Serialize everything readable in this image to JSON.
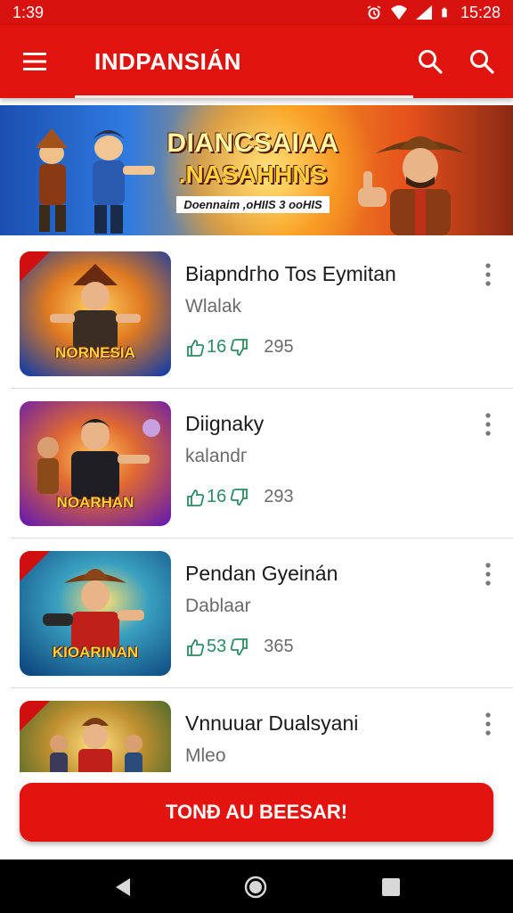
{
  "status_bar": {
    "time_left": "1:39",
    "time_right": "15:28",
    "icons": [
      "alarm-icon",
      "wifi-icon",
      "signal-icon",
      "battery-icon"
    ]
  },
  "app_bar": {
    "title": "INDPANSIÁN",
    "icons": [
      "menu-icon",
      "search-icon",
      "search-icon"
    ],
    "color": "#e0140f"
  },
  "banner": {
    "line1": "DIANCSAIAA",
    "line2": ".NASAHHNS",
    "line3": "Doennaim ,oHIIS 3 ooHIS"
  },
  "games": [
    {
      "title": "Biapndгho Tos Eymitan",
      "subtitle": "Wlalak",
      "likes": "16",
      "count": "295",
      "thumb_caption": "NORNESIA",
      "thumb_colors": [
        "#1b3fa0",
        "#f1a020"
      ]
    },
    {
      "title": "Diignaky",
      "subtitle": "kalandг",
      "likes": "16",
      "count": "293",
      "thumb_caption": "NOARHAN",
      "thumb_colors": [
        "#6d1ea8",
        "#f08a22"
      ]
    },
    {
      "title": "Pendan Gyeinán",
      "subtitle": "Dablaar",
      "likes": "53",
      "count": "365",
      "thumb_caption": "KIOARINAN",
      "thumb_colors": [
        "#0f6aa0",
        "#e85a18"
      ]
    },
    {
      "title": "Vnnuuar Dualsyani",
      "subtitle": "Mleo",
      "likes": "",
      "count": "",
      "thumb_caption": "",
      "thumb_colors": [
        "#2e7a2a",
        "#f0b030"
      ]
    }
  ],
  "cta": {
    "label": "TONÐ AU BEESAR!"
  },
  "nav": {
    "icons": [
      "back-icon",
      "home-icon",
      "recents-icon"
    ]
  }
}
